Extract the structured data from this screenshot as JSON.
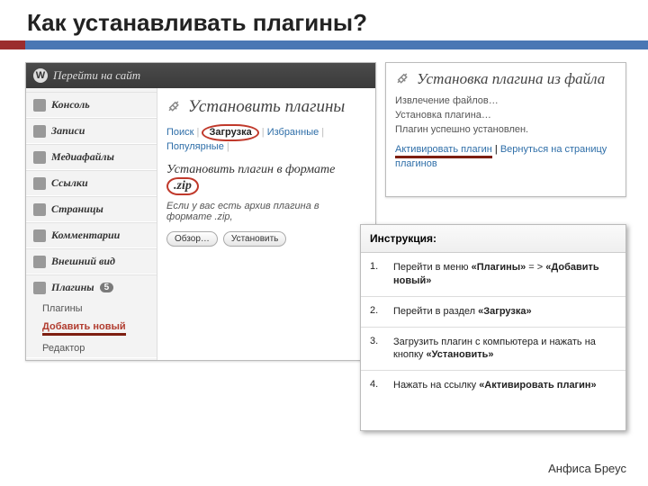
{
  "slide": {
    "title": "Как устанавливать плагины?",
    "author": "Анфиса Бреус"
  },
  "wp": {
    "topbar_label": "Перейти на сайт",
    "logo_char": "W",
    "sidebar": {
      "items": [
        {
          "label": "Консоль"
        },
        {
          "label": "Записи"
        },
        {
          "label": "Медиафайлы"
        },
        {
          "label": "Ссылки"
        },
        {
          "label": "Страницы"
        },
        {
          "label": "Комментарии"
        },
        {
          "label": "Внешний вид"
        }
      ],
      "plugins": {
        "label": "Плагины",
        "count": "5",
        "sub": [
          {
            "label": "Плагины"
          },
          {
            "label": "Добавить новый",
            "active": true
          },
          {
            "label": "Редактор"
          }
        ]
      }
    },
    "main": {
      "heading": "Установить плагины",
      "tabs": {
        "search": "Поиск",
        "upload": "Загрузка",
        "featured": "Избранные",
        "popular": "Популярные",
        "sep": "|"
      },
      "sub_heading_prefix": "Установить плагин в формате",
      "zip_label": ".zip",
      "hint_prefix": "Если у вас есть архив плагина в формате .zip,",
      "browse_btn": "Обзор…",
      "install_btn": "Установить"
    }
  },
  "install_panel": {
    "heading": "Установка плагина из файла",
    "line1": "Извлечение файлов…",
    "line2": "Установка плагина…",
    "line3": "Плагин успешно установлен.",
    "link_activate": "Активировать плагин",
    "link_sep": "|",
    "link_return": "Вернуться на страницу плагинов"
  },
  "instruction": {
    "title": "Инструкция:",
    "steps": [
      {
        "n": "1.",
        "text": "Перейти в меню «Плагины» = > «Добавить новый»",
        "bold": [
          "«Плагины»",
          "«Добавить новый»"
        ]
      },
      {
        "n": "2.",
        "text": "Перейти в раздел «Загрузка»",
        "bold": [
          "«Загрузка»"
        ]
      },
      {
        "n": "3.",
        "text": "Загрузить плагин с компьютера и нажать на кнопку «Установить»",
        "bold": [
          "«Установить»"
        ]
      },
      {
        "n": "4.",
        "text": "Нажать на ссылку «Активировать плагин»",
        "bold": [
          "«Активировать плагин»"
        ]
      }
    ]
  }
}
